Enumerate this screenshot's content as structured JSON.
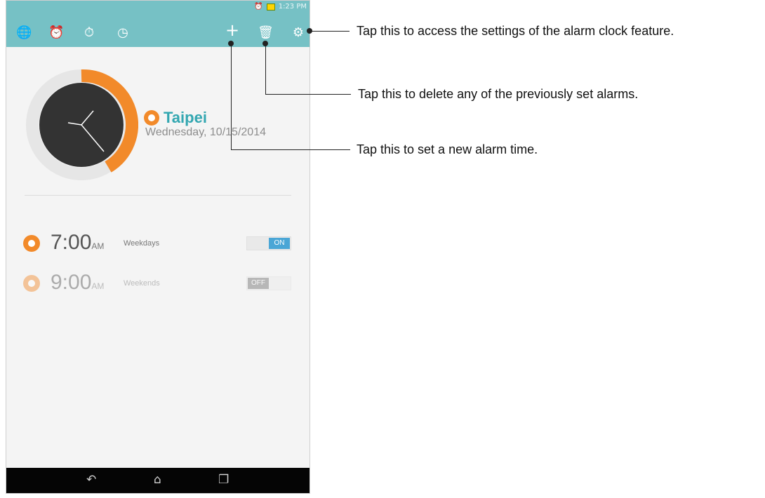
{
  "status_bar": {
    "time": "1:23 PM"
  },
  "toolbar": {
    "icons": [
      "world-clock-icon",
      "alarm-icon",
      "stopwatch-icon",
      "timer-icon",
      "add-icon",
      "delete-icon",
      "settings-icon"
    ],
    "background": "#76c1c5"
  },
  "world_clock": {
    "city": "Taipei",
    "date": "Wednesday, 10/15/2014"
  },
  "alarms": [
    {
      "time": "7:00",
      "ampm": "AM",
      "label": "Weekdays",
      "toggle": "ON",
      "enabled": true
    },
    {
      "time": "9:00",
      "ampm": "AM",
      "label": "Weekends",
      "toggle": "OFF",
      "enabled": false
    }
  ],
  "callouts": {
    "settings": "Tap this to access the settings of the alarm clock feature.",
    "delete": "Tap this to delete any of the previously set alarms.",
    "add": "Tap this to set a new alarm time."
  },
  "colors": {
    "accent_orange": "#f28a2a",
    "accent_teal": "#33a7b1",
    "toggle_on": "#4aa6d6",
    "toggle_off": "#8a8a8a"
  }
}
